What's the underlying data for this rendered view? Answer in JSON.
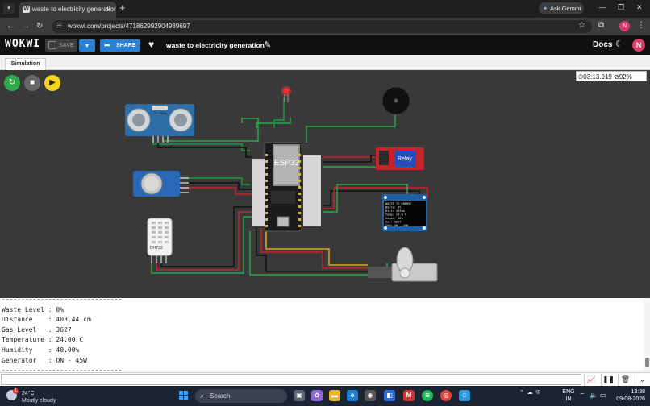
{
  "browser": {
    "tab_title": "waste to electricity generation",
    "tab_icon": "wokwi-favicon",
    "ask_gemini": "Ask Gemini",
    "url": "wokwi.com/projects/471862992904989697",
    "profile_initial": "N"
  },
  "wokwi": {
    "logo": "WOKWI",
    "save_label": "SAVE",
    "share_label": "SHARE",
    "project_title": "waste to electricity generation",
    "docs_label": "Docs",
    "avatar_initial": "N",
    "tab_simulation": "Simulation"
  },
  "simulation": {
    "timer": "03:13.919",
    "speed": "92%",
    "board_label": "ESP32",
    "relay_label": "Relay",
    "dht_label": "DHT22",
    "ultrasonic_label": "HC-SR04",
    "oled_lines": [
      "WASTE TO ENERGY",
      "Waste: 0%",
      "Dist: 403cm",
      "Temp: 24.0 C",
      "Humid: 40%",
      "Gas: 3627",
      "GEN: ON - 45W"
    ]
  },
  "serial": {
    "lines": [
      "-------------------------------",
      "Waste Level : 0%",
      "Distance    : 403.44 cm",
      "Gas Level   : 3627",
      "Temperature : 24.00 C",
      "Humidity    : 40.00%",
      "Generator   : ON - 45W",
      "-------------------------------"
    ]
  },
  "taskbar": {
    "temperature": "24°C",
    "condition": "Mostly cloudy",
    "search_placeholder": "Search",
    "lang_top": "ENG",
    "lang_bottom": "IN",
    "time": "13:38",
    "date": "09-08-2026"
  },
  "colors": {
    "accent": "#2a7fd4",
    "canvas_bg": "#393939",
    "run_green": "#2eaa4a",
    "play_yellow": "#f5d21f"
  }
}
